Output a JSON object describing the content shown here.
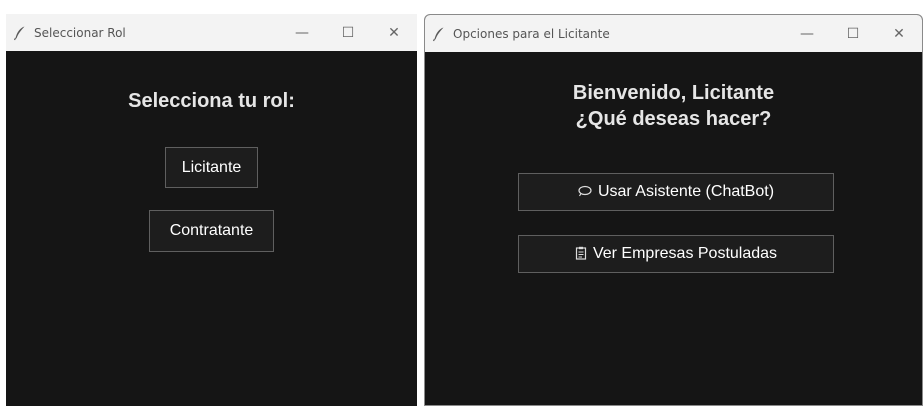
{
  "left_window": {
    "title": "Seleccionar Rol",
    "heading": "Selecciona tu rol:",
    "buttons": {
      "licitante": "Licitante",
      "contratante": "Contratante"
    }
  },
  "right_window": {
    "title": "Opciones para el Licitante",
    "heading_line1": "Bienvenido, Licitante",
    "heading_line2": "¿Qué deseas hacer?",
    "buttons": {
      "chatbot": "Usar Asistente (ChatBot)",
      "chatbot_icon": "speech-bubble-icon",
      "empresas": "Ver Empresas Postuladas",
      "empresas_icon": "clipboard-icon"
    }
  },
  "controls": {
    "minimize": "—",
    "maximize": "☐",
    "close": "✕"
  }
}
